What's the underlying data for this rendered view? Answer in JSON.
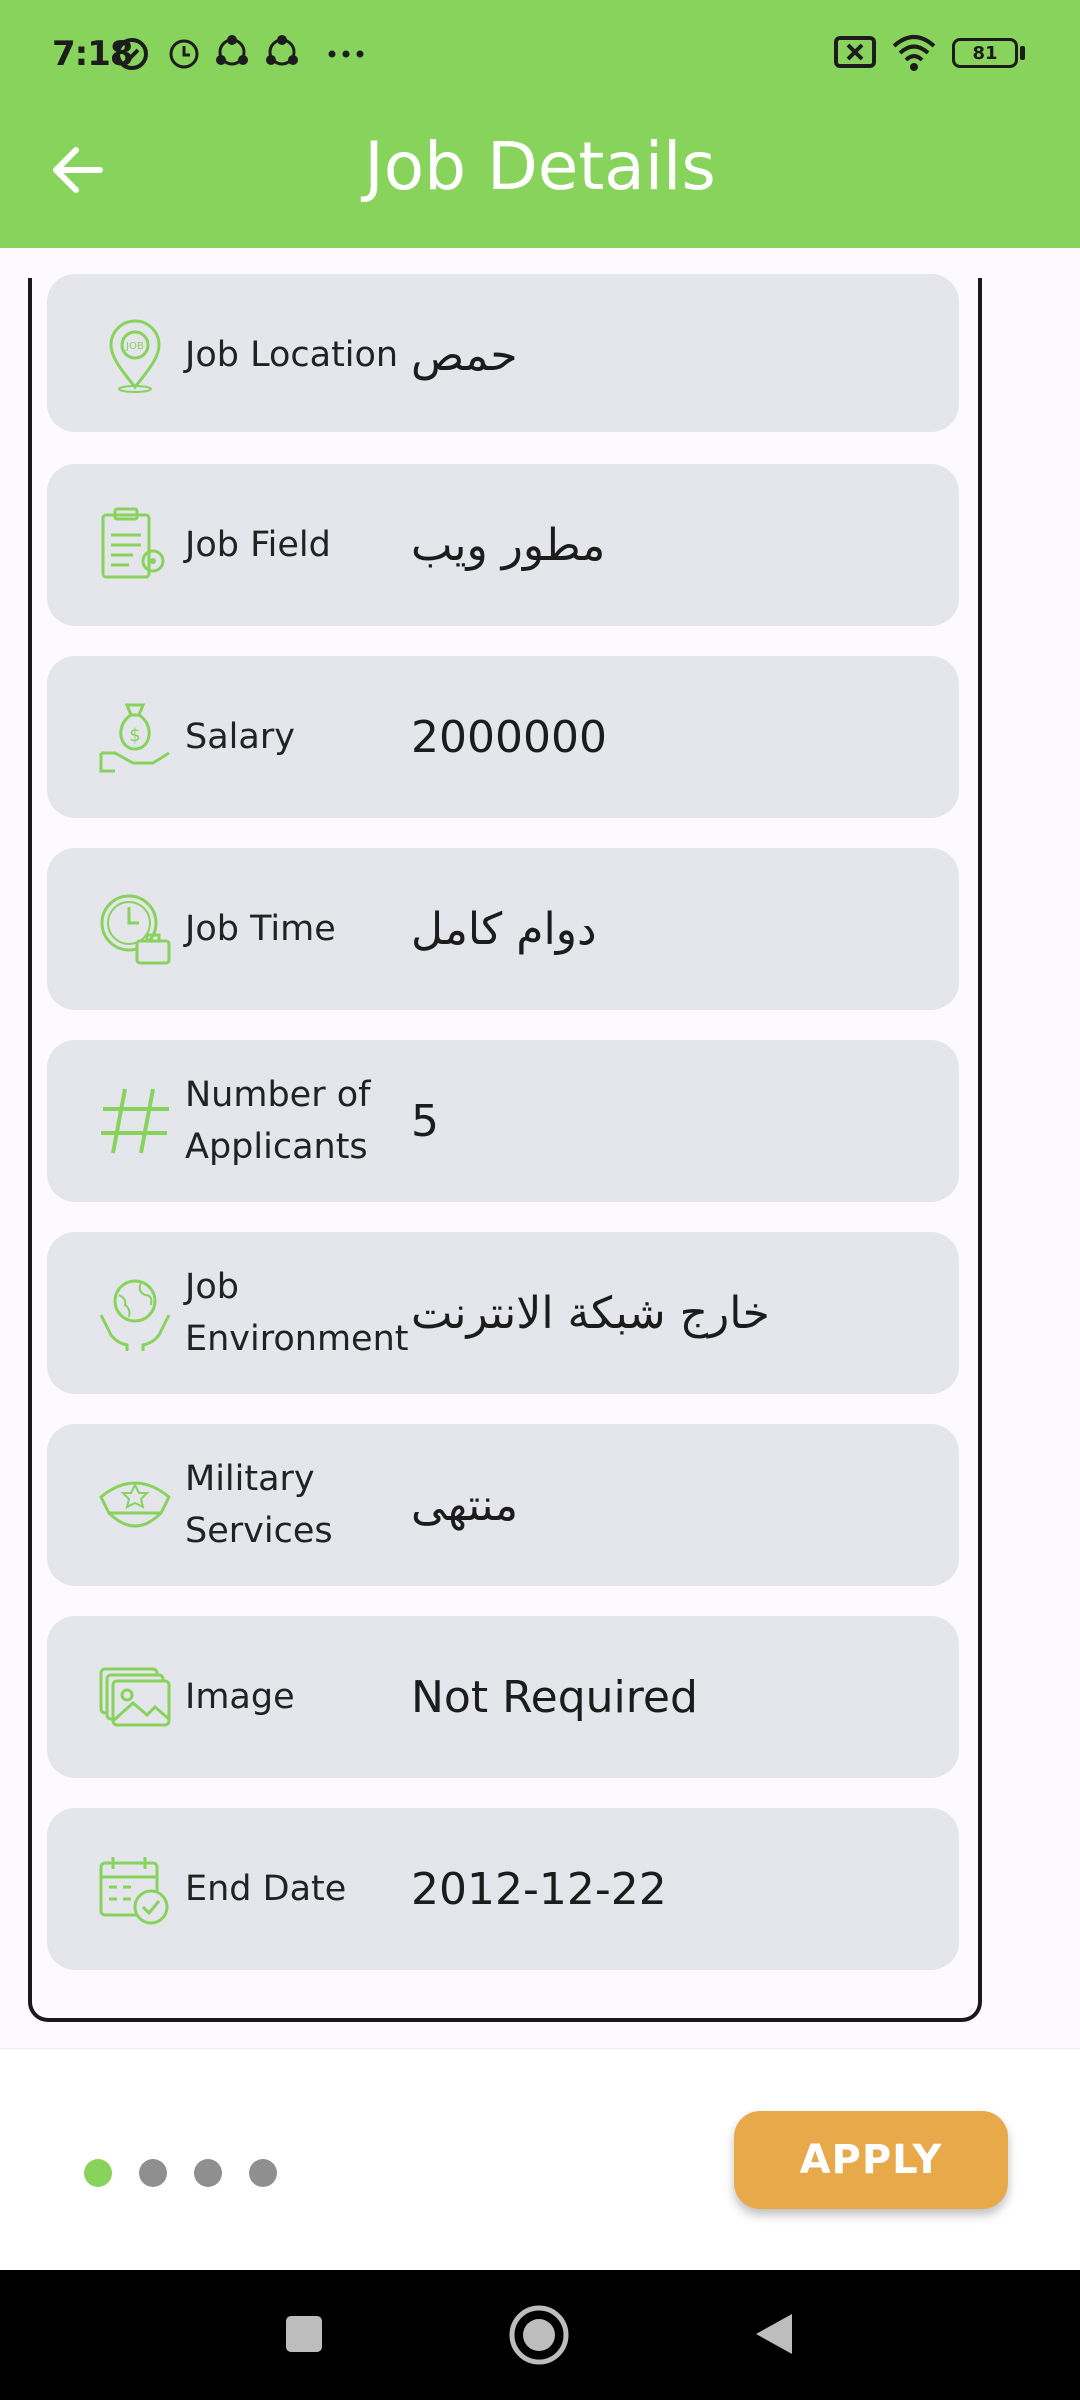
{
  "status_bar": {
    "time": "7:18",
    "battery": "81"
  },
  "header": {
    "title": "Job Details"
  },
  "details": [
    {
      "label": "Job Location",
      "value": "حمص",
      "icon": "location-pin-icon"
    },
    {
      "label": "Job Field",
      "value": "مطور ويب",
      "icon": "clipboard-gear-icon"
    },
    {
      "label": "Salary",
      "value": "2000000",
      "icon": "money-bag-hand-icon"
    },
    {
      "label": "Job Time",
      "value": "دوام كامل",
      "icon": "clock-briefcase-icon"
    },
    {
      "label": "Number of Applicants",
      "value": "5",
      "icon": "hash-icon"
    },
    {
      "label": "Job Environment",
      "value": "خارج شبكة الانترنت",
      "icon": "globe-hands-icon"
    },
    {
      "label": "Military Services",
      "value": "منتهى",
      "icon": "military-cap-icon"
    },
    {
      "label": "Image",
      "value": "Not Required",
      "icon": "image-stack-icon"
    },
    {
      "label": "End Date",
      "value": "2012-12-22",
      "icon": "calendar-icon"
    }
  ],
  "pager": {
    "count": 4,
    "active": 0
  },
  "footer": {
    "apply_label": "APPLY"
  },
  "colors": {
    "primary": "#88D35C",
    "accent": "#E8A94B",
    "card": "#E4E6EC"
  }
}
